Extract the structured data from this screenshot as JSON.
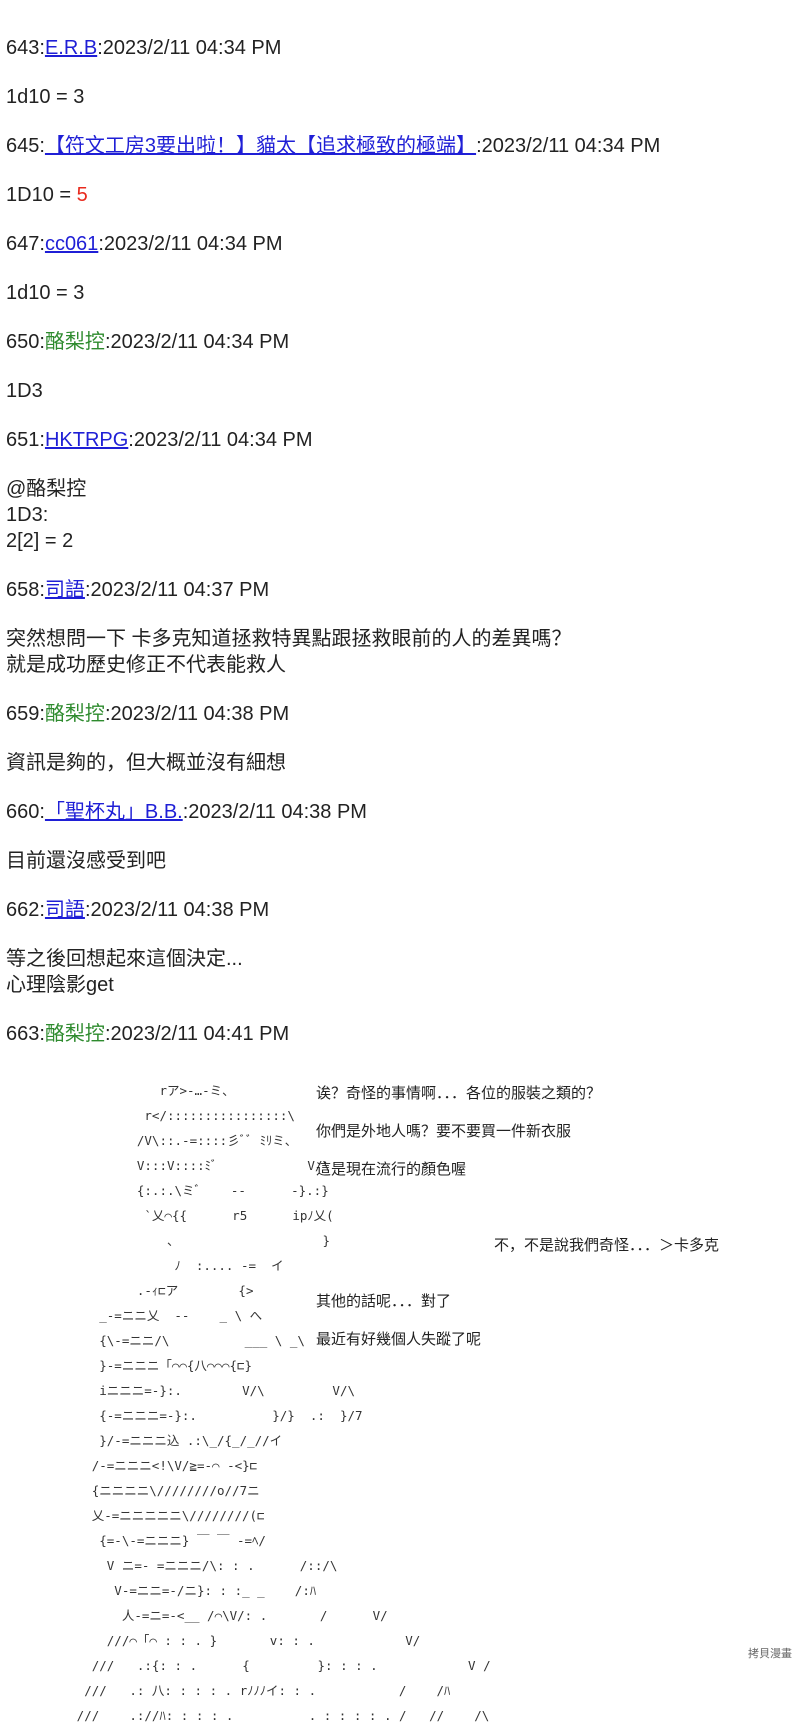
{
  "posts": [
    {
      "num": "643",
      "author": "E.R.B",
      "time": "2023/2/11 04:34 PM",
      "body_prefix": "1d10 = ",
      "body_value": "3"
    },
    {
      "num": "645",
      "author": "【符文工房3要出啦！】貓太【追求極致的極端】",
      "time": "2023/2/11 04:34 PM",
      "body_prefix": "1D10 = ",
      "body_value": "5"
    },
    {
      "num": "647",
      "author": "cc061",
      "time": "2023/2/11 04:34 PM",
      "body_prefix": "1d10 = ",
      "body_value": "3"
    },
    {
      "num": "650",
      "author": "酪梨控",
      "time": "2023/2/11 04:34 PM",
      "body": "1D3"
    },
    {
      "num": "651",
      "author": "HKTRPG",
      "time": "2023/2/11 04:34 PM",
      "body": "@酪梨控\n1D3:\n2[2] = 2"
    },
    {
      "num": "658",
      "author": "司語",
      "time": "2023/2/11 04:37 PM",
      "body": "突然想問一下 卡多克知道拯救特異點跟拯救眼前的人的差異嗎？\n就是成功歷史修正不代表能救人"
    },
    {
      "num": "659",
      "author": "酪梨控",
      "time": "2023/2/11 04:38 PM",
      "body": "資訊是夠的，但大概並沒有細想"
    },
    {
      "num": "660",
      "author": "「聖杯丸」B.B.",
      "time": "2023/2/11 04:38 PM",
      "body": "目前還沒感受到吧"
    },
    {
      "num": "662",
      "author": "司語",
      "time": "2023/2/11 04:38 PM",
      "body": "等之後回想起來這個決定...\n心理陰影get"
    },
    {
      "num": "663",
      "author": "酪梨控",
      "time": "2023/2/11 04:41 PM"
    }
  ],
  "aa_art": "                  rア>-…-ミ、\n                r</::::::::::::::::\\\n               /V\\::.-=::::彡ﾞﾞ ﾐﾘミ、\n               V:::V::::ﾐﾞ            V/\\\n               {:.:.\\ミﾞ    --      -}.:}\n                `乂⌒{{      r5      ipﾉ乂(\n                   、                   }\n                    ﾉ  :.... -=  イ\n               .-ｨ⊏ア        {>\n          _-=ニニ乂  --    _ \\ へ\n          {\\-=ニニ/\\          ___ \\ _\\\n          }-=ニニニ「⌒⌒{八⌒⌒⌒{⊏}\n          iニニニ=-}:.        V/\\         V/\\\n          {-=ニニニ=-}:.          }/}  .:  }/7\n          }/-=ニニニ込 .:\\_/{_/_//イ\n         /-=ニニニ<!\\V/≧=-⌒ -<}⊏\n         {ニニニニ\\////////o//7ニ\n         乂-=ニニニニニ\\////////(⊏\n          {=-\\-=ニニニ} ￣ ￣ -=ﾍ/\n           V ニ=- =ニニニ/\\: : .      /::/\\\n            V-=ニニ=-/ニ}: : :_ _    /:ﾊ\n             人-=ニ=-<__ /⌒\\V/: .       /      V/\n           ///⌒「⌒ : : . }       v: : .            V/\n         ///   .:{: : .      {         }: : : .            V /\n        ///   .: 八: : : : . rﾉﾉﾉイ: : .           /    /ﾊ\n       ///    .://ﾊ: : : : .          . : : : : . /   //    /\\",
  "dialogue": [
    "诶？奇怪的事情啊．．．各位的服裝之類的？",
    "你們是外地人嗎？要不要買一件新衣服",
    "這是現在流行的顏色喔",
    "不，不是說我們奇怪．．．＞卡多克",
    "其他的話呢．．．對了",
    "最近有好幾個人失蹤了呢"
  ],
  "watermark": "拷貝漫畫"
}
